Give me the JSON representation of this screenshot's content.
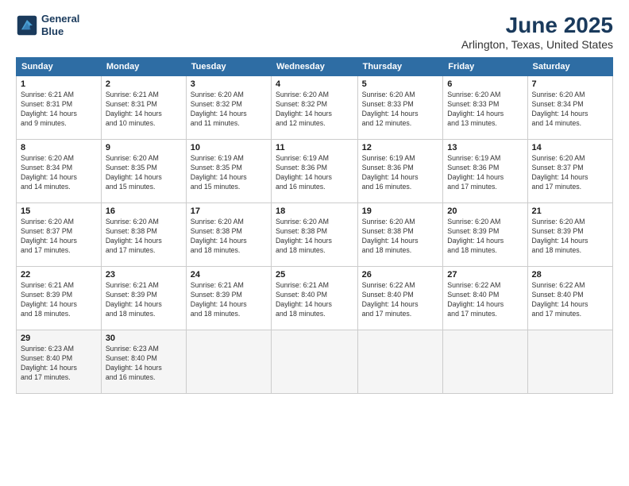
{
  "logo": {
    "line1": "General",
    "line2": "Blue"
  },
  "title": "June 2025",
  "subtitle": "Arlington, Texas, United States",
  "headers": [
    "Sunday",
    "Monday",
    "Tuesday",
    "Wednesday",
    "Thursday",
    "Friday",
    "Saturday"
  ],
  "weeks": [
    [
      {
        "day": "1",
        "info": "Sunrise: 6:21 AM\nSunset: 8:31 PM\nDaylight: 14 hours\nand 9 minutes."
      },
      {
        "day": "2",
        "info": "Sunrise: 6:21 AM\nSunset: 8:31 PM\nDaylight: 14 hours\nand 10 minutes."
      },
      {
        "day": "3",
        "info": "Sunrise: 6:20 AM\nSunset: 8:32 PM\nDaylight: 14 hours\nand 11 minutes."
      },
      {
        "day": "4",
        "info": "Sunrise: 6:20 AM\nSunset: 8:32 PM\nDaylight: 14 hours\nand 12 minutes."
      },
      {
        "day": "5",
        "info": "Sunrise: 6:20 AM\nSunset: 8:33 PM\nDaylight: 14 hours\nand 12 minutes."
      },
      {
        "day": "6",
        "info": "Sunrise: 6:20 AM\nSunset: 8:33 PM\nDaylight: 14 hours\nand 13 minutes."
      },
      {
        "day": "7",
        "info": "Sunrise: 6:20 AM\nSunset: 8:34 PM\nDaylight: 14 hours\nand 14 minutes."
      }
    ],
    [
      {
        "day": "8",
        "info": "Sunrise: 6:20 AM\nSunset: 8:34 PM\nDaylight: 14 hours\nand 14 minutes."
      },
      {
        "day": "9",
        "info": "Sunrise: 6:20 AM\nSunset: 8:35 PM\nDaylight: 14 hours\nand 15 minutes."
      },
      {
        "day": "10",
        "info": "Sunrise: 6:19 AM\nSunset: 8:35 PM\nDaylight: 14 hours\nand 15 minutes."
      },
      {
        "day": "11",
        "info": "Sunrise: 6:19 AM\nSunset: 8:36 PM\nDaylight: 14 hours\nand 16 minutes."
      },
      {
        "day": "12",
        "info": "Sunrise: 6:19 AM\nSunset: 8:36 PM\nDaylight: 14 hours\nand 16 minutes."
      },
      {
        "day": "13",
        "info": "Sunrise: 6:19 AM\nSunset: 8:36 PM\nDaylight: 14 hours\nand 17 minutes."
      },
      {
        "day": "14",
        "info": "Sunrise: 6:20 AM\nSunset: 8:37 PM\nDaylight: 14 hours\nand 17 minutes."
      }
    ],
    [
      {
        "day": "15",
        "info": "Sunrise: 6:20 AM\nSunset: 8:37 PM\nDaylight: 14 hours\nand 17 minutes."
      },
      {
        "day": "16",
        "info": "Sunrise: 6:20 AM\nSunset: 8:38 PM\nDaylight: 14 hours\nand 17 minutes."
      },
      {
        "day": "17",
        "info": "Sunrise: 6:20 AM\nSunset: 8:38 PM\nDaylight: 14 hours\nand 18 minutes."
      },
      {
        "day": "18",
        "info": "Sunrise: 6:20 AM\nSunset: 8:38 PM\nDaylight: 14 hours\nand 18 minutes."
      },
      {
        "day": "19",
        "info": "Sunrise: 6:20 AM\nSunset: 8:38 PM\nDaylight: 14 hours\nand 18 minutes."
      },
      {
        "day": "20",
        "info": "Sunrise: 6:20 AM\nSunset: 8:39 PM\nDaylight: 14 hours\nand 18 minutes."
      },
      {
        "day": "21",
        "info": "Sunrise: 6:20 AM\nSunset: 8:39 PM\nDaylight: 14 hours\nand 18 minutes."
      }
    ],
    [
      {
        "day": "22",
        "info": "Sunrise: 6:21 AM\nSunset: 8:39 PM\nDaylight: 14 hours\nand 18 minutes."
      },
      {
        "day": "23",
        "info": "Sunrise: 6:21 AM\nSunset: 8:39 PM\nDaylight: 14 hours\nand 18 minutes."
      },
      {
        "day": "24",
        "info": "Sunrise: 6:21 AM\nSunset: 8:39 PM\nDaylight: 14 hours\nand 18 minutes."
      },
      {
        "day": "25",
        "info": "Sunrise: 6:21 AM\nSunset: 8:40 PM\nDaylight: 14 hours\nand 18 minutes."
      },
      {
        "day": "26",
        "info": "Sunrise: 6:22 AM\nSunset: 8:40 PM\nDaylight: 14 hours\nand 17 minutes."
      },
      {
        "day": "27",
        "info": "Sunrise: 6:22 AM\nSunset: 8:40 PM\nDaylight: 14 hours\nand 17 minutes."
      },
      {
        "day": "28",
        "info": "Sunrise: 6:22 AM\nSunset: 8:40 PM\nDaylight: 14 hours\nand 17 minutes."
      }
    ],
    [
      {
        "day": "29",
        "info": "Sunrise: 6:23 AM\nSunset: 8:40 PM\nDaylight: 14 hours\nand 17 minutes."
      },
      {
        "day": "30",
        "info": "Sunrise: 6:23 AM\nSunset: 8:40 PM\nDaylight: 14 hours\nand 16 minutes."
      },
      {
        "day": "",
        "info": ""
      },
      {
        "day": "",
        "info": ""
      },
      {
        "day": "",
        "info": ""
      },
      {
        "day": "",
        "info": ""
      },
      {
        "day": "",
        "info": ""
      }
    ]
  ]
}
